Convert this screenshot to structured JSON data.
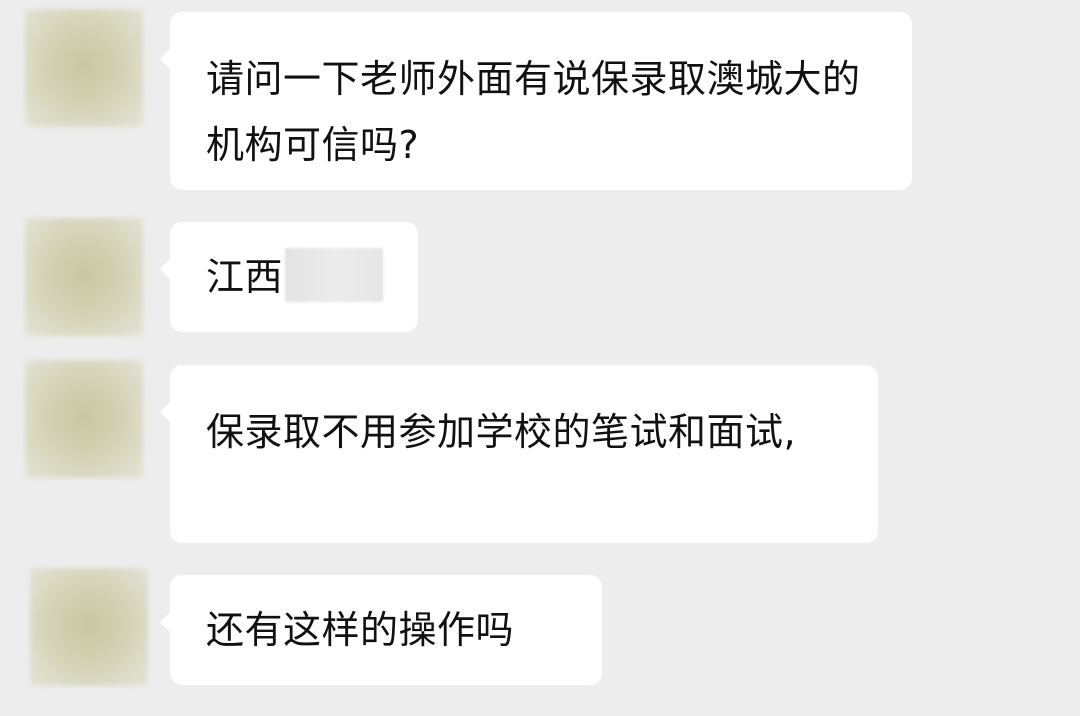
{
  "chat": {
    "messages": [
      {
        "text": "请问一下老师外面有说保录取澳城大的机构可信吗?"
      },
      {
        "text": "江西",
        "redacted_suffix": true
      },
      {
        "text": "保录取不用参加学校的笔试和面试,"
      },
      {
        "text": "还有这样的操作吗"
      }
    ]
  },
  "colors": {
    "background": "#ededed",
    "bubble": "#ffffff",
    "text": "#111111",
    "avatar_blur": "#d0ceac"
  }
}
